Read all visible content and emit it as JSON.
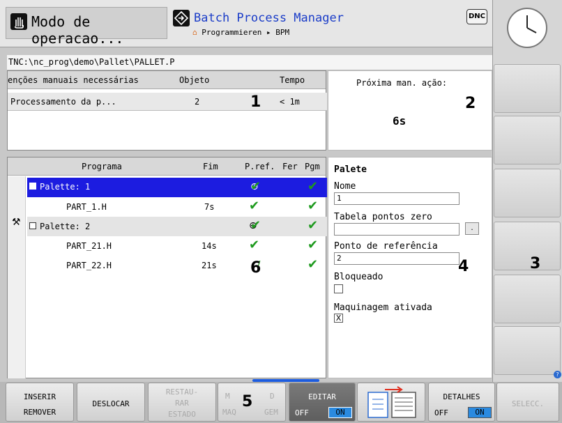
{
  "header": {
    "mode_label": "Modo de operacao...",
    "app_title": "Batch Process Manager",
    "breadcrumb": "Programmieren ▸ BPM",
    "dnc_badge": "DNC"
  },
  "path": "TNC:\\nc_prog\\demo\\Pallet\\PALLET.P",
  "manual_table": {
    "headers": [
      "enções manuais necessárias",
      "Objeto",
      "Tempo"
    ],
    "rows": [
      {
        "name": "Processamento da p...",
        "object": "2",
        "time": "< 1m"
      }
    ]
  },
  "next_action": {
    "label": "Próxima man. ação:",
    "value": "6s"
  },
  "program_table": {
    "headers": [
      "Programa",
      "Fim",
      "P.ref.",
      "Fer",
      "Pgm"
    ],
    "rows": [
      {
        "name": "Palette: 1",
        "fim": "",
        "selected": true
      },
      {
        "name": "PART_1.H",
        "fim": "7s"
      },
      {
        "name": "Palette: 2",
        "fim": ""
      },
      {
        "name": "PART_21.H",
        "fim": "14s"
      },
      {
        "name": "PART_22.H",
        "fim": "21s"
      }
    ]
  },
  "palette_panel": {
    "title": "Palete",
    "name_label": "Nome",
    "name_value": "1",
    "zero_table_label": "Tabela pontos zero",
    "zero_table_value": "",
    "browse_label": ".",
    "ref_point_label": "Ponto de referência",
    "ref_point_value": "2",
    "locked_label": "Bloqueado",
    "locked_checked": false,
    "machining_label": "Maquinagem ativada",
    "machining_checked": true,
    "machining_mark": "X"
  },
  "callouts": [
    "1",
    "2",
    "3",
    "4",
    "5",
    "6"
  ],
  "softkeys": {
    "insert_line1": "INSERIR",
    "insert_line2": "REMOVER",
    "move": "DESLOCAR",
    "restore_l1": "RESTAU-",
    "restore_l2": "RAR",
    "restore_l3": "ESTADO",
    "machine_l1": "M",
    "machine_l2": "D",
    "machine_l3": "MAQ",
    "machine_l4": "GEM",
    "edit": "EDITAR",
    "edit_off": "OFF",
    "edit_on": "ON",
    "details": "DETALHES",
    "details_off": "OFF",
    "details_on": "ON",
    "select": "SELECC."
  },
  "colors": {
    "selection": "#1c1ce0",
    "check": "#1e9a1e",
    "title_blue": "#1a3cc8"
  }
}
